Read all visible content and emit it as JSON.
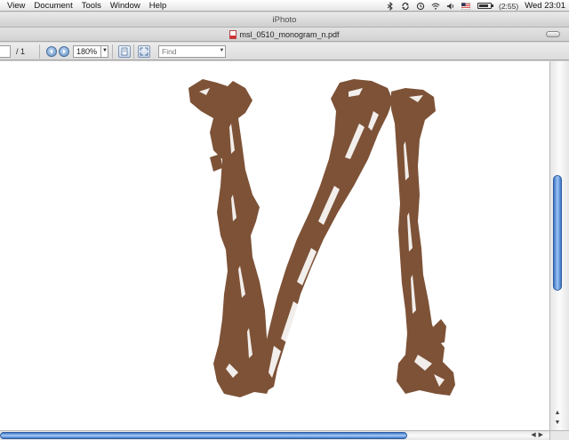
{
  "menubar": {
    "items": [
      "View",
      "Document",
      "Tools",
      "Window",
      "Help"
    ],
    "battery_text": "(2:55)",
    "clock": "Wed 23:01"
  },
  "window": {
    "title": "iPhoto"
  },
  "document": {
    "filename": "msl_0510_monogram_n.pdf"
  },
  "toolbar": {
    "page_total": "/ 1",
    "zoom": "180%",
    "find_placeholder": "Find"
  },
  "colors": {
    "monogram_brown": "#7d5237",
    "scroll_blue": "#3b76c9"
  },
  "icons": [
    "bluetooth-icon",
    "sync-icon",
    "time-machine-icon",
    "wifi-icon",
    "volume-icon",
    "flag-icon",
    "battery-icon",
    "pdf-file-icon",
    "previous-page-icon",
    "next-page-icon",
    "single-page-icon",
    "fit-page-icon"
  ]
}
